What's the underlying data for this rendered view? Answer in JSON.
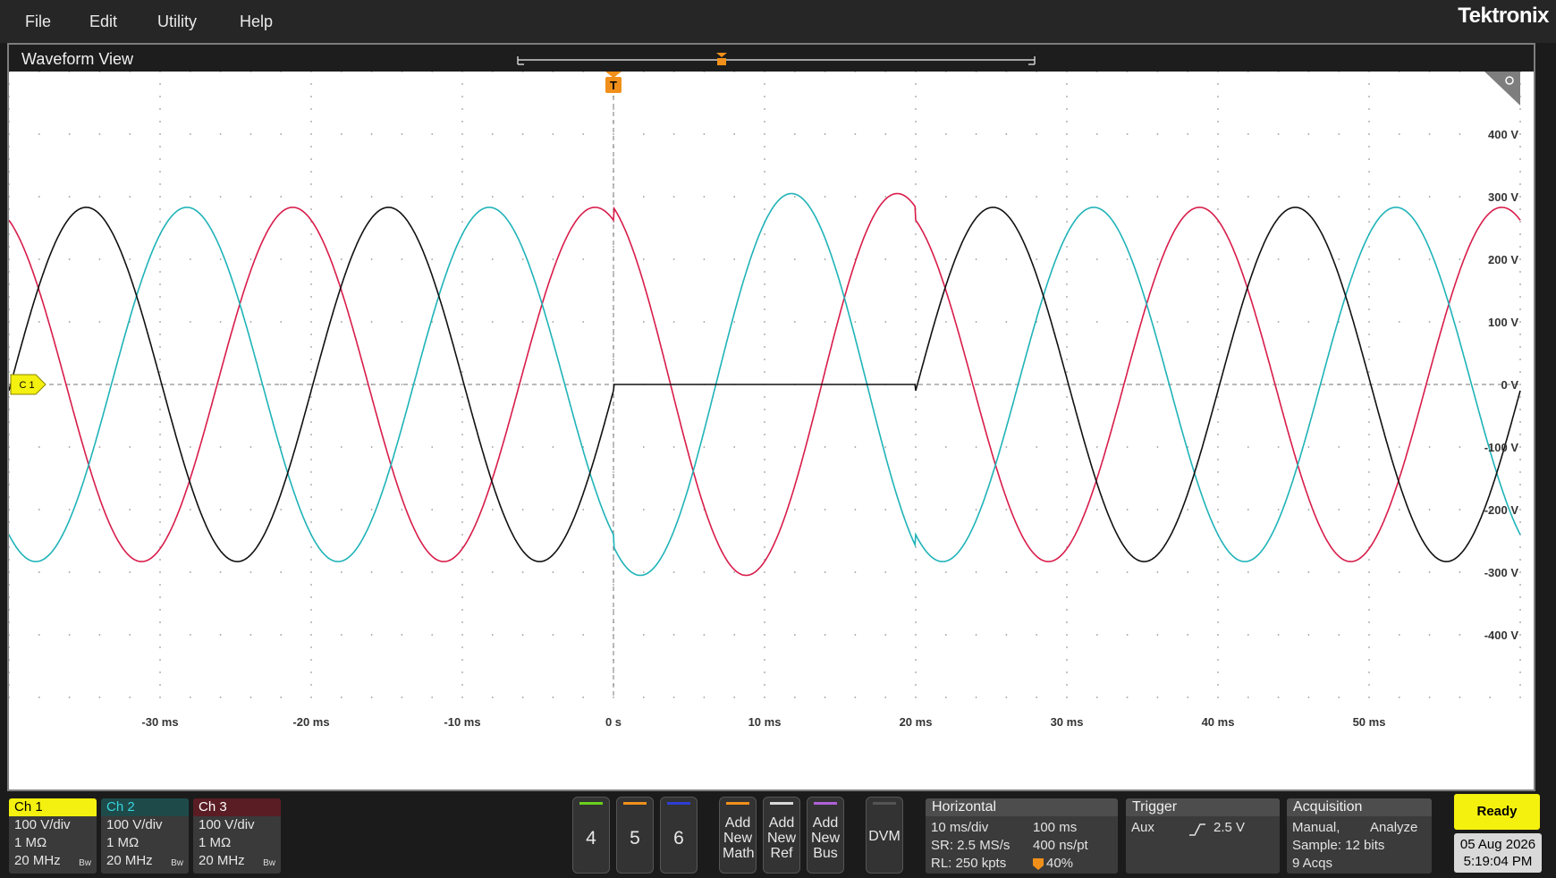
{
  "menu": {
    "items": [
      "File",
      "Edit",
      "Utility",
      "Help"
    ],
    "brand": "Tektronix"
  },
  "waveform_view": {
    "title": "Waveform View",
    "trigger_marker": "T",
    "ch1_marker": "C 1",
    "y_labels": [
      "400 V",
      "300 V",
      "200 V",
      "100 V",
      "0 V",
      "-100 V",
      "-200 V",
      "-300 V",
      "-400 V"
    ],
    "x_labels": [
      "-30 ms",
      "-20 ms",
      "-10 ms",
      "0 s",
      "10 ms",
      "20 ms",
      "30 ms",
      "40 ms",
      "50 ms"
    ]
  },
  "chart_data": {
    "type": "line",
    "xlabel": "",
    "ylabel": "",
    "x_unit": "ms",
    "y_unit": "V",
    "xlim": [
      -40,
      60
    ],
    "ylim": [
      -500,
      500
    ],
    "grid": true,
    "frequency_hz": 50,
    "series": [
      {
        "name": "",
        "color": "#d81c4a",
        "amplitude_v": 283,
        "phase_deg_at_0": 112,
        "fault": "overshoot",
        "fault_amplitude_v": 305,
        "fault_window_ms": [
          0,
          20
        ]
      },
      {
        "name": "",
        "color": "#1fb3b8",
        "amplitude_v": 283,
        "phase_deg_at_0": -122,
        "fault": "overshoot",
        "fault_amplitude_v": 305,
        "fault_window_ms": [
          0,
          20
        ]
      },
      {
        "name": "",
        "color": "#111111",
        "amplitude_v": 283,
        "phase_deg_at_0": -2,
        "fault": "zero",
        "fault_window_ms": [
          0,
          20
        ]
      }
    ]
  },
  "channels": [
    {
      "name": "Ch 1",
      "scale": "100 V/div",
      "impedance": "1 MΩ",
      "bandwidth": "20 MHz",
      "bw_icon": "Bw",
      "head_bg": "#f4f00f",
      "head_fg": "#000000"
    },
    {
      "name": "Ch 2",
      "scale": "100 V/div",
      "impedance": "1 MΩ",
      "bandwidth": "20 MHz",
      "bw_icon": "Bw",
      "head_bg": "#1f4a4a",
      "head_fg": "#35d6dc"
    },
    {
      "name": "Ch 3",
      "scale": "100 V/div",
      "impedance": "1 MΩ",
      "bandwidth": "20 MHz",
      "bw_icon": "Bw",
      "head_bg": "#5a1d24",
      "head_fg": "#ffffff"
    }
  ],
  "extra_channels": [
    {
      "label": "4",
      "color": "#6bd11d"
    },
    {
      "label": "5",
      "color": "#f0901a"
    },
    {
      "label": "6",
      "color": "#2d3fd2"
    }
  ],
  "add_buttons": [
    {
      "label": "Add New Math",
      "color": "#f0901a"
    },
    {
      "label": "Add New Ref",
      "color": "#d8d8d8"
    },
    {
      "label": "Add New Bus",
      "color": "#b061d8"
    }
  ],
  "dvm": {
    "label": "DVM"
  },
  "horizontal": {
    "title": "Horizontal",
    "scale": "10 ms/div",
    "record_time": "100 ms",
    "sample_rate": "SR: 2.5 MS/s",
    "time_per_point": "400 ns/pt",
    "record_length": "RL: 250 kpts",
    "position_icon": "trigger-position-icon",
    "position": "40%"
  },
  "trigger": {
    "title": "Trigger",
    "source": "Aux",
    "slope_icon": "rising-edge-icon",
    "level": "2.5 V"
  },
  "acquisition": {
    "title": "Acquisition",
    "mode": "Manual,",
    "analyze": "Analyze",
    "sample": "Sample: 12 bits",
    "acqs": "9 Acqs"
  },
  "status": {
    "ready": "Ready",
    "date": "05 Aug 2026",
    "time": "5:19:04 PM"
  }
}
